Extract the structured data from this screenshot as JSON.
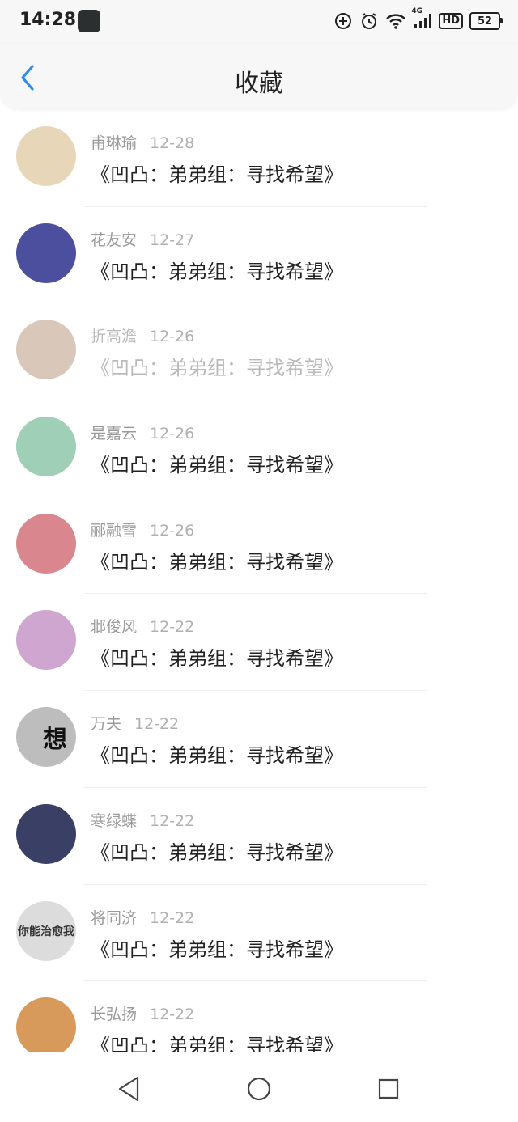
{
  "status": {
    "time": "14:28",
    "network": "4G",
    "hd": "HD",
    "battery": "52"
  },
  "header": {
    "title": "收藏"
  },
  "items": [
    {
      "name": "甫琳瑜",
      "date": "12-28",
      "title": "《凹凸：弟弟组：寻找希望》",
      "avatar_bg": "#e8d6b9",
      "avatar_text": "",
      "faded": false
    },
    {
      "name": "花友安",
      "date": "12-27",
      "title": "《凹凸：弟弟组：寻找希望》",
      "avatar_bg": "#4b4f9e",
      "avatar_text": "",
      "faded": false
    },
    {
      "name": "折高澹",
      "date": "12-26",
      "title": "《凹凸：弟弟组：寻找希望》",
      "avatar_bg": "#b99a82",
      "avatar_text": "",
      "faded": true
    },
    {
      "name": "是嘉云",
      "date": "12-26",
      "title": "《凹凸：弟弟组：寻找希望》",
      "avatar_bg": "#9fcfb6",
      "avatar_text": "",
      "faded": false
    },
    {
      "name": "郦融雪",
      "date": "12-26",
      "title": "《凹凸：弟弟组：寻找希望》",
      "avatar_bg": "#d9868e",
      "avatar_text": "",
      "faded": false
    },
    {
      "name": "邶俊风",
      "date": "12-22",
      "title": "《凹凸：弟弟组：寻找希望》",
      "avatar_bg": "#cfa6cf",
      "avatar_text": "",
      "faded": false
    },
    {
      "name": "万夫",
      "date": "12-22",
      "title": "《凹凸：弟弟组：寻找希望》",
      "avatar_bg": "#bdbdbd",
      "avatar_text": "想",
      "faded": false
    },
    {
      "name": "寒绿蝶",
      "date": "12-22",
      "title": "《凹凸：弟弟组：寻找希望》",
      "avatar_bg": "#3a3f66",
      "avatar_text": "",
      "faded": false
    },
    {
      "name": "将同济",
      "date": "12-22",
      "title": "《凹凸：弟弟组：寻找希望》",
      "avatar_bg": "#dddcdc",
      "avatar_text": "你能治愈我",
      "faded": false
    },
    {
      "name": "长弘扬",
      "date": "12-22",
      "title": "《凹凸：弟弟组：寻找希望》",
      "avatar_bg": "#d89a5a",
      "avatar_text": "",
      "faded": false
    }
  ]
}
